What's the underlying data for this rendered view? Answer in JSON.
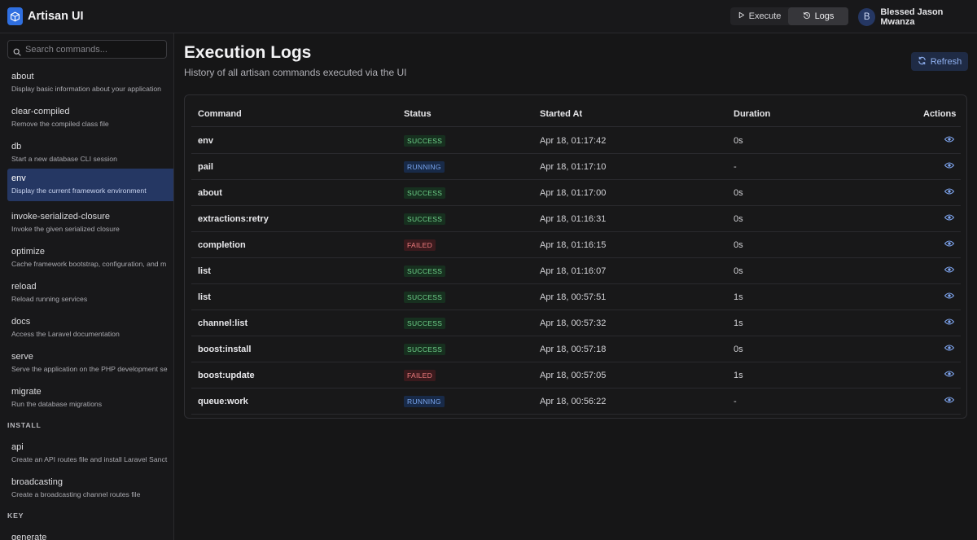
{
  "app": {
    "title": "Artisan UI"
  },
  "nav": {
    "execute_label": "Execute",
    "logs_label": "Logs"
  },
  "user": {
    "initial": "B",
    "name": "Blessed Jason Mwanza"
  },
  "sidebar": {
    "search_placeholder": "Search commands...",
    "items": [
      {
        "name": "about",
        "desc": "Display basic information about your application"
      },
      {
        "name": "clear-compiled",
        "desc": "Remove the compiled class file"
      },
      {
        "name": "db",
        "desc": "Start a new database CLI session"
      },
      {
        "name": "env",
        "desc": "Display the current framework environment",
        "active": true
      },
      {
        "name": "invoke-serialized-closure",
        "desc": "Invoke the given serialized closure"
      },
      {
        "name": "optimize",
        "desc": "Cache framework bootstrap, configuration, and m"
      },
      {
        "name": "reload",
        "desc": "Reload running services"
      },
      {
        "name": "docs",
        "desc": "Access the Laravel documentation"
      },
      {
        "name": "serve",
        "desc": "Serve the application on the PHP development se"
      },
      {
        "name": "migrate",
        "desc": "Run the database migrations"
      }
    ],
    "sections": [
      {
        "label": "INSTALL",
        "items": [
          {
            "name": "api",
            "desc": "Create an API routes file and install Laravel Sanct"
          },
          {
            "name": "broadcasting",
            "desc": "Create a broadcasting channel routes file"
          }
        ]
      },
      {
        "label": "KEY",
        "items": [
          {
            "name": "generate",
            "desc": ""
          }
        ]
      }
    ]
  },
  "main": {
    "title": "Execution Logs",
    "subtitle": "History of all artisan commands executed via the UI",
    "refresh_label": "Refresh",
    "columns": [
      "Command",
      "Status",
      "Started At",
      "Duration",
      "Actions"
    ],
    "rows": [
      {
        "command": "env",
        "status": "SUCCESS",
        "started": "Apr 18, 01:17:42",
        "duration": "0s"
      },
      {
        "command": "pail",
        "status": "RUNNING",
        "started": "Apr 18, 01:17:10",
        "duration": "-"
      },
      {
        "command": "about",
        "status": "SUCCESS",
        "started": "Apr 18, 01:17:00",
        "duration": "0s"
      },
      {
        "command": "extractions:retry",
        "status": "SUCCESS",
        "started": "Apr 18, 01:16:31",
        "duration": "0s"
      },
      {
        "command": "completion",
        "status": "FAILED",
        "started": "Apr 18, 01:16:15",
        "duration": "0s"
      },
      {
        "command": "list",
        "status": "SUCCESS",
        "started": "Apr 18, 01:16:07",
        "duration": "0s"
      },
      {
        "command": "list",
        "status": "SUCCESS",
        "started": "Apr 18, 00:57:51",
        "duration": "1s"
      },
      {
        "command": "channel:list",
        "status": "SUCCESS",
        "started": "Apr 18, 00:57:32",
        "duration": "1s"
      },
      {
        "command": "boost:install",
        "status": "SUCCESS",
        "started": "Apr 18, 00:57:18",
        "duration": "0s"
      },
      {
        "command": "boost:update",
        "status": "FAILED",
        "started": "Apr 18, 00:57:05",
        "duration": "1s"
      },
      {
        "command": "queue:work",
        "status": "RUNNING",
        "started": "Apr 18, 00:56:22",
        "duration": "-"
      }
    ]
  },
  "icons": {
    "logo": "cube-icon",
    "execute": "play-icon",
    "logs": "history-icon",
    "search": "search-icon",
    "refresh": "refresh-icon",
    "view": "eye-icon"
  },
  "colors": {
    "accent": "#253763",
    "success": "#6fd18a",
    "running": "#7aa6ee",
    "failed": "#f07d7f"
  }
}
